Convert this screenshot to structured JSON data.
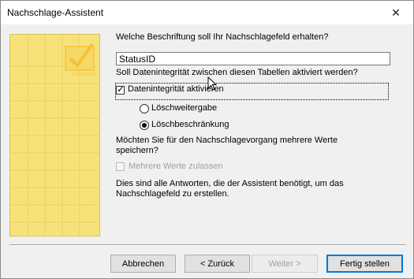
{
  "window": {
    "title": "Nachschlage-Assistent",
    "close_glyph": "✕"
  },
  "question": {
    "caption_prompt": "Welche Beschriftung soll Ihr Nachschlagefeld erhalten?",
    "caption_value": "StatusID",
    "integrity_prompt": "Soll Datenintegrität zwischen diesen Tabellen aktiviert werden?",
    "integrity_checkbox_label": "Datenintegrität aktivieren",
    "integrity_checked": true,
    "radio_options": [
      "Löschweitergabe",
      "Löschbeschränkung"
    ],
    "radio_selected": "Löschbeschränkung",
    "multi_prompt_line1": "Möchten Sie für den Nachschlagevorgang mehrere Werte",
    "multi_prompt_line2": "speichern?",
    "multi_checkbox_label": "Mehrere Werte zulassen",
    "summary_line1": "Dies sind alle Antworten, die der Assistent benötigt, um das",
    "summary_line2": "Nachschlagefeld zu erstellen."
  },
  "buttons": {
    "cancel": "Abbrechen",
    "back": "< Zurück",
    "next": "Weiter >",
    "finish": "Fertig stellen"
  },
  "colors": {
    "art_panel": "#f7e27a",
    "default_button_border": "#0078d7"
  }
}
